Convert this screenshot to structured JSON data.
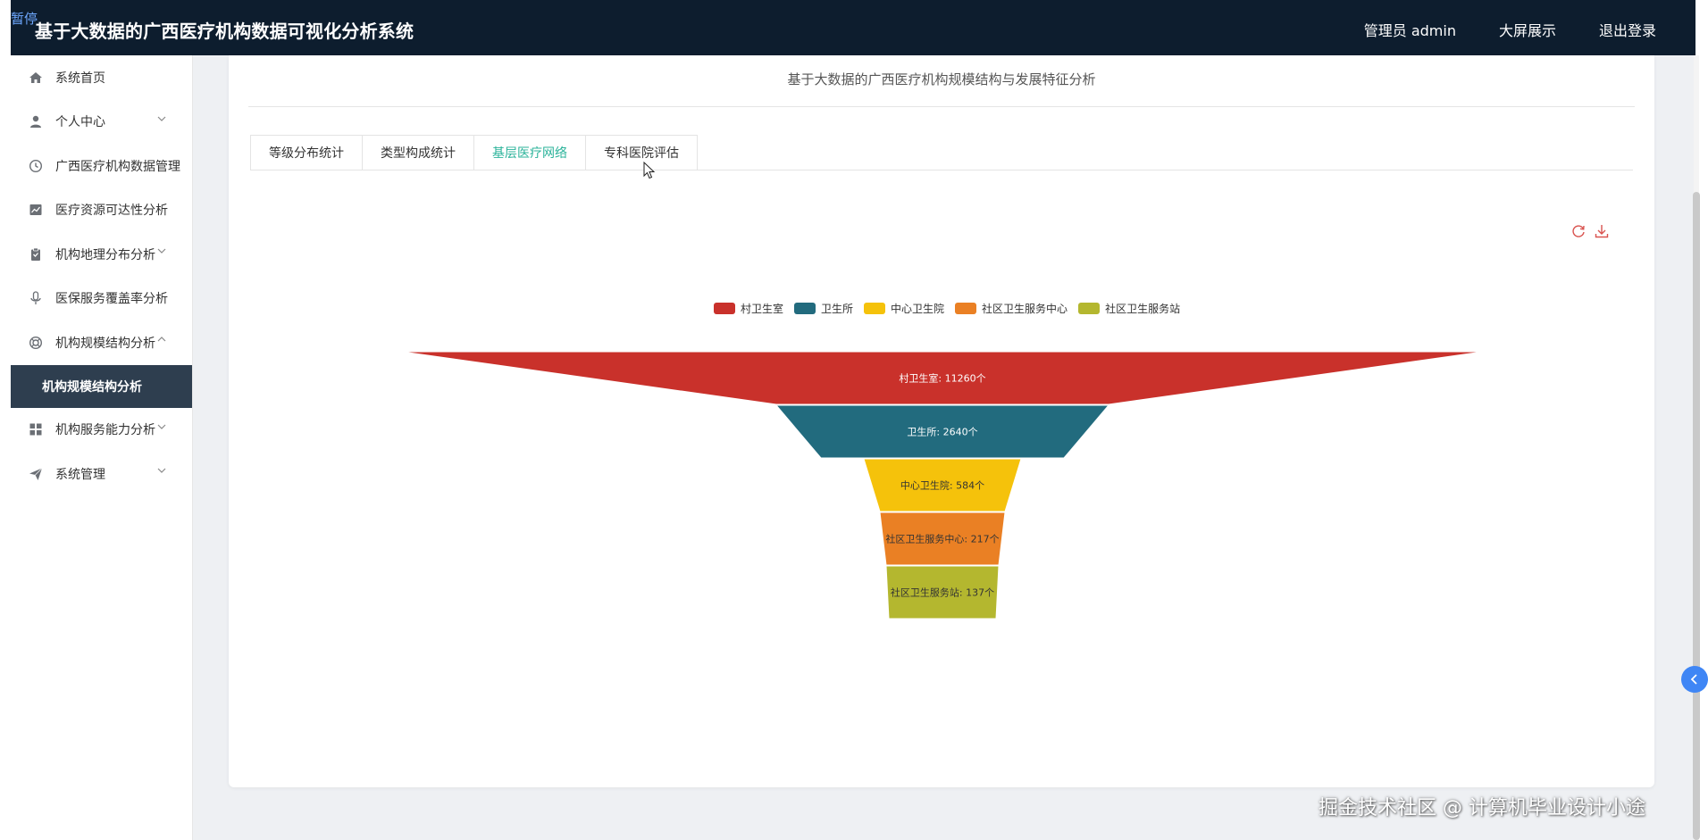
{
  "header": {
    "pause_tag": "暂停",
    "title": "基于大数据的广西医疗机构数据可视化分析系统",
    "nav": [
      "管理员 admin",
      "大屏展示",
      "退出登录"
    ]
  },
  "sidebar": {
    "items": [
      {
        "label": "系统首页",
        "icon": "home-icon"
      },
      {
        "label": "个人中心",
        "icon": "user-icon",
        "arrow": "down"
      },
      {
        "label": "广西医疗机构数据管理",
        "icon": "clock-icon"
      },
      {
        "label": "医疗资源可达性分析",
        "icon": "chart-icon"
      },
      {
        "label": "机构地理分布分析",
        "icon": "clipboard-icon",
        "arrow": "down"
      },
      {
        "label": "医保服务覆盖率分析",
        "icon": "microphone-icon"
      },
      {
        "label": "机构规模结构分析",
        "icon": "lifebuoy-icon",
        "arrow": "up"
      },
      {
        "label": "机构规模结构分析",
        "sub": true
      },
      {
        "label": "机构服务能力分析",
        "icon": "grid-icon",
        "arrow": "down"
      },
      {
        "label": "系统管理",
        "icon": "send-icon",
        "arrow": "down"
      }
    ]
  },
  "main": {
    "heading": "基于大数据的广西医疗机构规模结构与发展特征分析",
    "tabs": [
      {
        "label": "等级分布统计",
        "active": false
      },
      {
        "label": "类型构成统计",
        "active": false
      },
      {
        "label": "基层医疗网络",
        "active": true
      },
      {
        "label": "专科医院评估",
        "active": false
      }
    ],
    "tools": [
      "refresh-icon",
      "download-icon"
    ]
  },
  "chart_data": {
    "type": "funnel",
    "title": "",
    "unit": "个",
    "categories": [
      "村卫生室",
      "卫生所",
      "中心卫生院",
      "社区卫生服务中心",
      "社区卫生服务站"
    ],
    "values": [
      11260,
      2640,
      584,
      217,
      137
    ],
    "labels": [
      "村卫生室: 11260个",
      "卫生所: 2640个",
      "中心卫生院: 584个",
      "社区卫生服务中心: 217个",
      "社区卫生服务站: 137个"
    ],
    "colors": [
      "#c9312b",
      "#226b7e",
      "#f5c20b",
      "#ea8024",
      "#b4b72f"
    ],
    "legend_position": "top-center"
  },
  "watermark": "掘金技术社区 @ 计算机毕业设计小途"
}
